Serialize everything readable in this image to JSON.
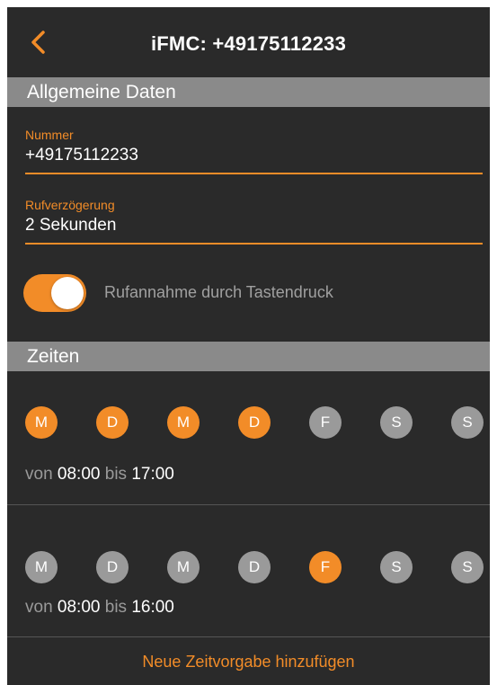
{
  "nav": {
    "title": "iFMC: +49175112233",
    "back_icon": "chevron-left-icon"
  },
  "sections": {
    "general": "Allgemeine Daten",
    "times": "Zeiten"
  },
  "fields": {
    "number": {
      "label": "Nummer",
      "value": "+49175112233"
    },
    "delay": {
      "label": "Rufverzögerung",
      "value": "2 Sekunden"
    }
  },
  "toggle": {
    "label": "Rufannahme durch Tastendruck",
    "on": true
  },
  "schedules": [
    {
      "days": [
        {
          "letter": "M",
          "active": true
        },
        {
          "letter": "D",
          "active": true
        },
        {
          "letter": "M",
          "active": true
        },
        {
          "letter": "D",
          "active": true
        },
        {
          "letter": "F",
          "active": false
        },
        {
          "letter": "S",
          "active": false
        },
        {
          "letter": "S",
          "active": false
        }
      ],
      "from_label": "von",
      "from": "08:00",
      "to_label": "bis",
      "to": "17:00"
    },
    {
      "days": [
        {
          "letter": "M",
          "active": false
        },
        {
          "letter": "D",
          "active": false
        },
        {
          "letter": "M",
          "active": false
        },
        {
          "letter": "D",
          "active": false
        },
        {
          "letter": "F",
          "active": true
        },
        {
          "letter": "S",
          "active": false
        },
        {
          "letter": "S",
          "active": false
        }
      ],
      "from_label": "von",
      "from": "08:00",
      "to_label": "bis",
      "to": "16:00"
    }
  ],
  "add_schedule": "Neue Zeitvorgabe hinzufügen",
  "colors": {
    "accent": "#f28c28",
    "background": "#2a2a2a",
    "section_header": "#8a8a8a",
    "inactive_day": "#9a9a9a"
  }
}
